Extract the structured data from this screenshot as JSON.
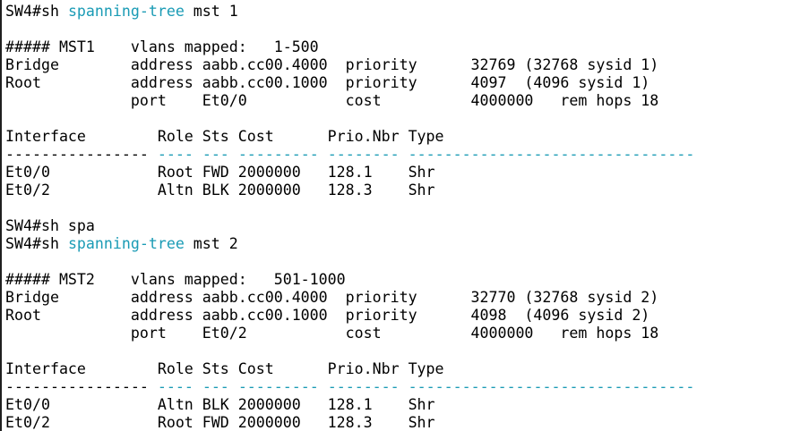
{
  "colors": {
    "background": "#ffffff",
    "text": "#000000",
    "command_highlight": "#1a9bb5",
    "left_border": "#1f1f1f"
  },
  "lines": [
    [
      {
        "t": "SW4#sh ",
        "c": ""
      },
      {
        "t": "spanning-tree",
        "c": "kw"
      },
      {
        "t": " mst 1",
        "c": ""
      }
    ],
    [
      {
        "t": "",
        "c": ""
      }
    ],
    [
      {
        "t": "##### MST1    vlans mapped:   1-500",
        "c": ""
      }
    ],
    [
      {
        "t": "Bridge        address aabb.cc00.4000  priority      32769 (32768 sysid 1)",
        "c": ""
      }
    ],
    [
      {
        "t": "Root          address aabb.cc00.1000  priority      4097  (4096 sysid 1)",
        "c": ""
      }
    ],
    [
      {
        "t": "              port    Et0/0           cost          4000000   rem hops 18",
        "c": ""
      }
    ],
    [
      {
        "t": "",
        "c": ""
      }
    ],
    [
      {
        "t": "Interface        Role Sts Cost      Prio.Nbr Type",
        "c": ""
      }
    ],
    [
      {
        "t": "----------------",
        "c": "dash-black"
      },
      {
        "t": " ",
        "c": ""
      },
      {
        "t": "----",
        "c": "dash-blue"
      },
      {
        "t": " ",
        "c": ""
      },
      {
        "t": "---",
        "c": "dash-blue"
      },
      {
        "t": " ",
        "c": ""
      },
      {
        "t": "---------",
        "c": "dash-blue"
      },
      {
        "t": " ",
        "c": ""
      },
      {
        "t": "--------",
        "c": "dash-blue"
      },
      {
        "t": " ",
        "c": ""
      },
      {
        "t": "--------------------------------",
        "c": "dash-blue"
      }
    ],
    [
      {
        "t": "Et0/0            Root FWD 2000000   128.1    Shr",
        "c": ""
      }
    ],
    [
      {
        "t": "Et0/2            Altn BLK 2000000   128.3    Shr",
        "c": ""
      }
    ],
    [
      {
        "t": "",
        "c": ""
      }
    ],
    [
      {
        "t": "SW4#sh spa",
        "c": ""
      }
    ],
    [
      {
        "t": "SW4#sh ",
        "c": ""
      },
      {
        "t": "spanning-tree",
        "c": "kw"
      },
      {
        "t": " mst 2",
        "c": ""
      }
    ],
    [
      {
        "t": "",
        "c": ""
      }
    ],
    [
      {
        "t": "##### MST2    vlans mapped:   501-1000",
        "c": ""
      }
    ],
    [
      {
        "t": "Bridge        address aabb.cc00.4000  priority      32770 (32768 sysid 2)",
        "c": ""
      }
    ],
    [
      {
        "t": "Root          address aabb.cc00.1000  priority      4098  (4096 sysid 2)",
        "c": ""
      }
    ],
    [
      {
        "t": "              port    Et0/2           cost          4000000   rem hops 18",
        "c": ""
      }
    ],
    [
      {
        "t": "",
        "c": ""
      }
    ],
    [
      {
        "t": "Interface        Role Sts Cost      Prio.Nbr Type",
        "c": ""
      }
    ],
    [
      {
        "t": "----------------",
        "c": "dash-black"
      },
      {
        "t": " ",
        "c": ""
      },
      {
        "t": "----",
        "c": "dash-blue"
      },
      {
        "t": " ",
        "c": ""
      },
      {
        "t": "---",
        "c": "dash-blue"
      },
      {
        "t": " ",
        "c": ""
      },
      {
        "t": "---------",
        "c": "dash-blue"
      },
      {
        "t": " ",
        "c": ""
      },
      {
        "t": "--------",
        "c": "dash-blue"
      },
      {
        "t": " ",
        "c": ""
      },
      {
        "t": "--------------------------------",
        "c": "dash-blue"
      }
    ],
    [
      {
        "t": "Et0/0            Altn BLK 2000000   128.1    Shr",
        "c": ""
      }
    ],
    [
      {
        "t": "Et0/2            Root FWD 2000000   128.3    Shr",
        "c": ""
      }
    ]
  ]
}
